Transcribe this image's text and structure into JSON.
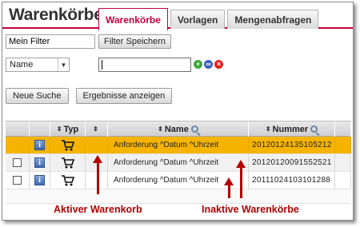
{
  "header": {
    "title": "Warenkörbe",
    "tabs": [
      {
        "label": "Warenkörbe",
        "active": true
      },
      {
        "label": "Vorlagen",
        "active": false
      },
      {
        "label": "Mengenabfragen",
        "active": false
      }
    ]
  },
  "filter": {
    "name_value": "Mein Filter",
    "save_label": "Filter Speichern"
  },
  "criteria": {
    "field_selected": "Name",
    "value": "",
    "icons": [
      "add-icon",
      "link-icon",
      "remove-icon"
    ]
  },
  "actions": {
    "new_search_label": "Neue Suche",
    "show_results_label": "Ergebnisse anzeigen"
  },
  "table": {
    "columns": {
      "typ": "Typ",
      "name": "Name",
      "nummer": "Nummer"
    },
    "rows": [
      {
        "name": "Anforderung ^Datum ^Uhrzeit",
        "nummer": "20120124135105212",
        "active": true
      },
      {
        "name": "Anforderung ^Datum ^Uhrzeit",
        "nummer": "20120120091552521",
        "active": false
      },
      {
        "name": "Anforderung ^Datum ^Uhrzeit",
        "nummer": "20111024103101288",
        "active": false
      }
    ]
  },
  "annotations": {
    "active_cart": "Aktiver Warenkorb",
    "inactive_carts": "Inaktive Warenkörbe"
  },
  "colors": {
    "accent": "#c5003e",
    "active_row": "#f6b400",
    "annotation": "#b30000"
  }
}
